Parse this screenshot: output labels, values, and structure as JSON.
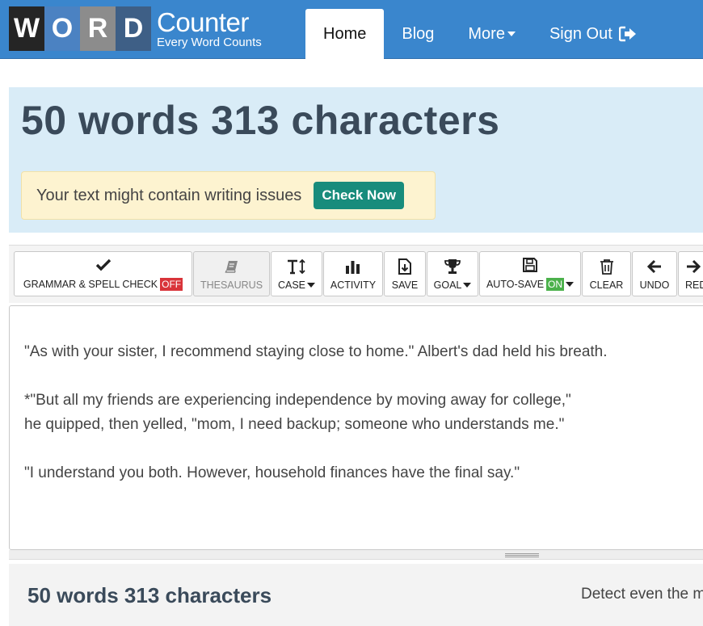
{
  "logo": {
    "tiles": [
      "W",
      "O",
      "R",
      "D"
    ],
    "title": "Counter",
    "tagline": "Every Word Counts"
  },
  "nav": {
    "home": "Home",
    "blog": "Blog",
    "more": "More",
    "sign_out": "Sign Out"
  },
  "banner": {
    "count_text": "50 words 313 characters",
    "issues_text": "Your text might contain writing issues",
    "check_now": "Check Now"
  },
  "toolbar": {
    "grammar": "GRAMMAR & SPELL CHECK",
    "grammar_state": "OFF",
    "thesaurus": "THESAURUS",
    "case": "CASE",
    "activity": "ACTIVITY",
    "save": "SAVE",
    "goal": "GOAL",
    "autosave": "AUTO-SAVE",
    "autosave_state": "ON",
    "clear": "CLEAR",
    "undo": "UNDO",
    "redo": "RED"
  },
  "editor": {
    "lines": [
      "\"As with your sister, I recommend staying close to home.\" Albert's dad held his breath.",
      "*\"But all my friends are experiencing independence by moving away for college,\"",
      "he quipped, then yelled, \"mom, I need backup; someone who understands me.\"",
      "\"I understand you both. However, household finances have the final say.\""
    ]
  },
  "summary": {
    "count_text": "50 words 313 characters",
    "detect_text": "Detect even the m"
  },
  "colors": {
    "navbar": "#3a86cd",
    "banner": "#d9ecf7",
    "check_now": "#188c7c",
    "off_badge": "#d9343a",
    "on_badge": "#4bb14b"
  }
}
